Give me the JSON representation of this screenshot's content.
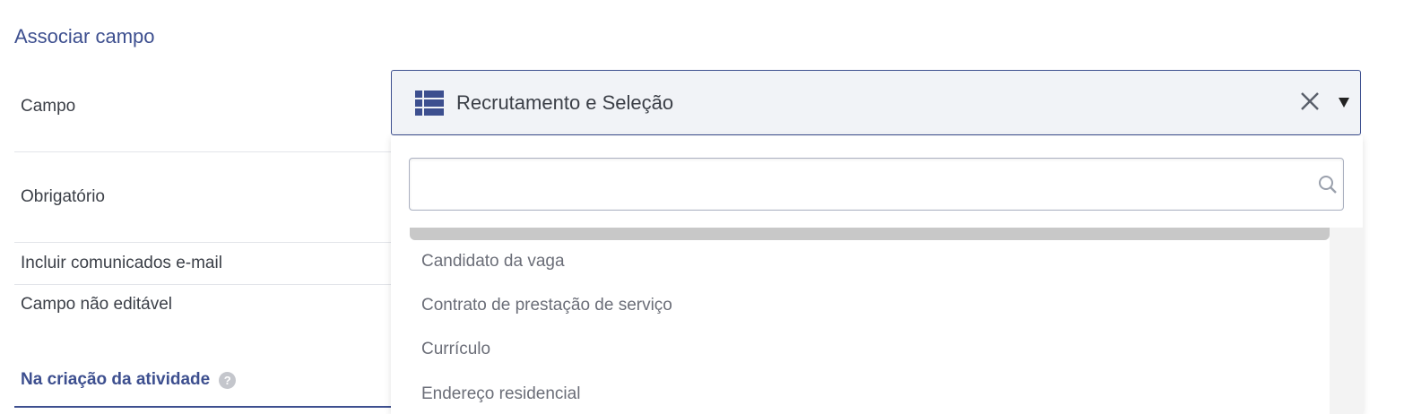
{
  "section": {
    "title": "Associar campo"
  },
  "rows": [
    {
      "label": "Campo"
    },
    {
      "label": "Obrigatório"
    },
    {
      "label": "Incluir comunicados e-mail"
    },
    {
      "label": "Campo não editável"
    }
  ],
  "subsection": {
    "title": "Na criação da atividade",
    "help_icon": "?"
  },
  "select": {
    "value": "Recrutamento e Seleção",
    "icon": "list-icon"
  },
  "dropdown": {
    "search_placeholder": "",
    "options": [
      {
        "label": "Candidato da vaga"
      },
      {
        "label": "Contrato de prestação de serviço"
      },
      {
        "label": "Currículo"
      },
      {
        "label": "Endereço residencial"
      }
    ]
  },
  "colors": {
    "accent": "#3d4f8f",
    "select_bg": "#f1f3f7"
  }
}
